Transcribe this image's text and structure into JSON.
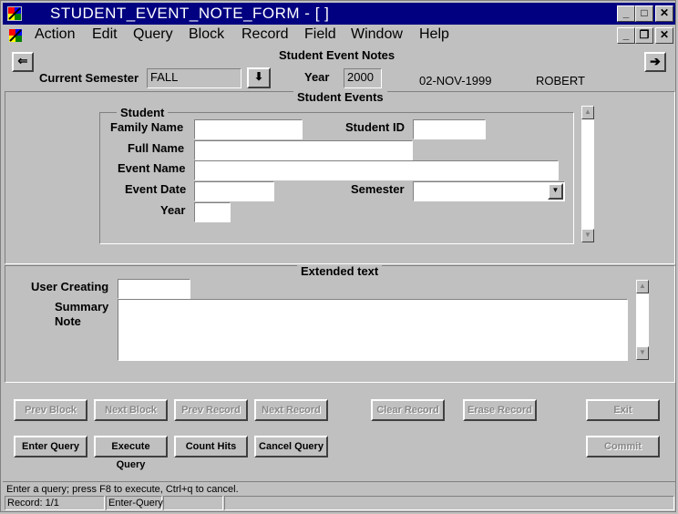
{
  "window": {
    "title": "STUDENT_EVENT_NOTE_FORM - [ ]"
  },
  "menu": [
    "Action",
    "Edit",
    "Query",
    "Block",
    "Record",
    "Field",
    "Window",
    "Help"
  ],
  "header": {
    "title": "Student Event Notes",
    "current_semester_label": "Current Semester",
    "current_semester_value": "FALL",
    "year_label": "Year",
    "year_value": "2000",
    "date": "02-NOV-1999",
    "user": "ROBERT"
  },
  "events": {
    "section_title": "Student Events",
    "group_title": "Student",
    "family_name_label": "Family Name",
    "student_id_label": "Student ID",
    "full_name_label": "Full Name",
    "event_name_label": "Event Name",
    "event_date_label": "Event Date",
    "semester_label": "Semester",
    "year_label": "Year"
  },
  "extended": {
    "section_title": "Extended text",
    "user_creating_label": "User Creating",
    "summary_label_1": "Summary",
    "summary_label_2": "Note"
  },
  "buttons": {
    "prev_block": "Prev Block",
    "next_block": "Next Block",
    "prev_record": "Prev Record",
    "next_record": "Next Record",
    "clear_record": "Clear Record",
    "erase_record": "Erase Record",
    "exit": "Exit",
    "enter_query": "Enter Query",
    "execute_query": "Execute Query",
    "count_hits": "Count Hits",
    "cancel_query": "Cancel Query",
    "commit": "Commit"
  },
  "statusbar": {
    "message": "Enter a query;  press F8 to execute, Ctrl+q  to cancel.",
    "record": "Record: 1/1",
    "mode": "Enter-Query"
  },
  "colors": {
    "titlebar": "#000080",
    "face": "#c0c0c0",
    "field": "#ffffff"
  }
}
